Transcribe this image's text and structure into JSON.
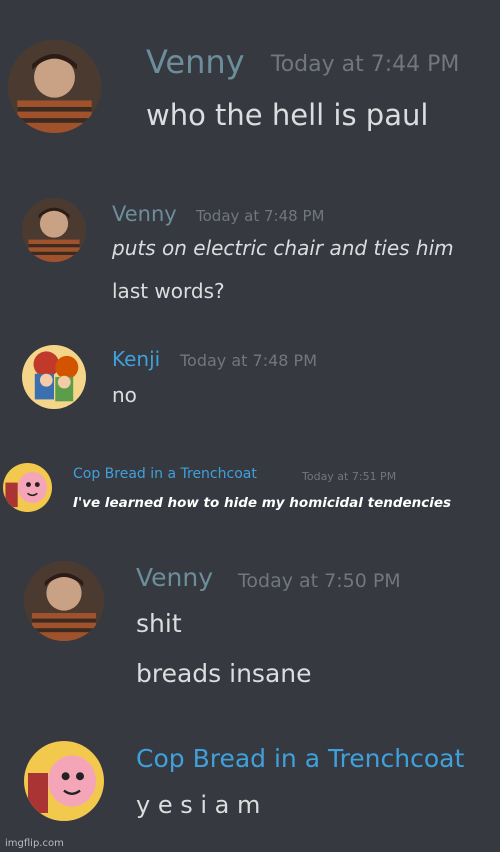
{
  "colors": {
    "background": "#36393f",
    "venny_name": "#6c8e9c",
    "blue_name": "#3fa0dc",
    "text": "#dcddde",
    "timestamp": "#72767d"
  },
  "messages": [
    {
      "author": "Venny",
      "timestamp": "Today at 7:44 PM",
      "lines": [
        "who the hell is paul"
      ],
      "avatar_icon": "boy-in-striped-sweater-avatar"
    },
    {
      "author": "Venny",
      "timestamp": "Today at 7:48 PM",
      "lines": [
        "puts on electric chair and ties him",
        "last words?"
      ],
      "avatar_icon": "boy-in-striped-sweater-avatar"
    },
    {
      "author": "Kenji",
      "timestamp": "Today at 7:48 PM",
      "lines": [
        "no"
      ],
      "avatar_icon": "cartoon-characters-avatar"
    },
    {
      "author": "Cop Bread in a Trenchcoat",
      "timestamp": "Today at 7:51 PM",
      "lines": [
        "I've learned how to hide my homicidal tendencies"
      ],
      "avatar_icon": "cartoon-bread-avatar"
    },
    {
      "author": "Venny",
      "timestamp": "Today at 7:50 PM",
      "lines": [
        "shit",
        "breads insane"
      ],
      "avatar_icon": "boy-in-striped-sweater-avatar"
    },
    {
      "author": "Cop Bread in a Trenchcoat",
      "timestamp": "",
      "lines": [
        "y e s i a m"
      ],
      "avatar_icon": "cartoon-bread-avatar"
    }
  ],
  "watermark": "imgflip.com"
}
